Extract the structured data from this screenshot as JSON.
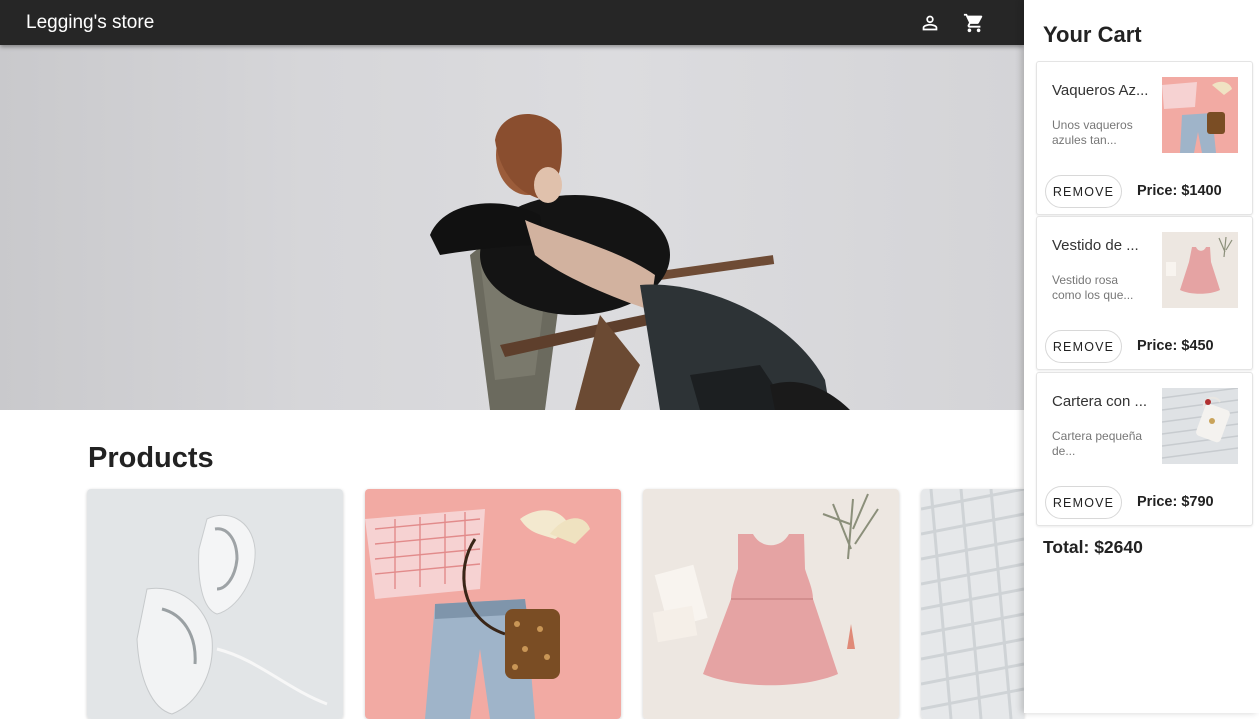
{
  "appbar": {
    "title": "Legging's store",
    "icons": {
      "account": "account-icon",
      "cart": "shopping-cart-icon"
    },
    "background": "#262626"
  },
  "hero": {
    "image": "woman-lounging-on-chair-photo"
  },
  "products": {
    "title": "Products",
    "cards": [
      {
        "image": "white-sneakers-photo"
      },
      {
        "image": "jeans-and-bag-flatlay-photo"
      },
      {
        "image": "pink-dress-flatlay-photo"
      },
      {
        "image": "white-knit-sweater-photo"
      }
    ]
  },
  "cart": {
    "title": "Your Cart",
    "items": [
      {
        "name": "Vaqueros Az...",
        "description": "Unos vaqueros azules tan...",
        "remove_label": "REMOVE",
        "price": "Price: $1400",
        "thumb": "jeans-and-bag-thumb"
      },
      {
        "name": "Vestido de ...",
        "description": "Vestido rosa como los que...",
        "remove_label": "REMOVE",
        "price": "Price: $450",
        "thumb": "pink-dress-thumb"
      },
      {
        "name": "Cartera con ...",
        "description": "Cartera pequeña de...",
        "remove_label": "REMOVE",
        "price": "Price: $790",
        "thumb": "white-purse-thumb"
      }
    ],
    "total": "Total: $2640"
  }
}
